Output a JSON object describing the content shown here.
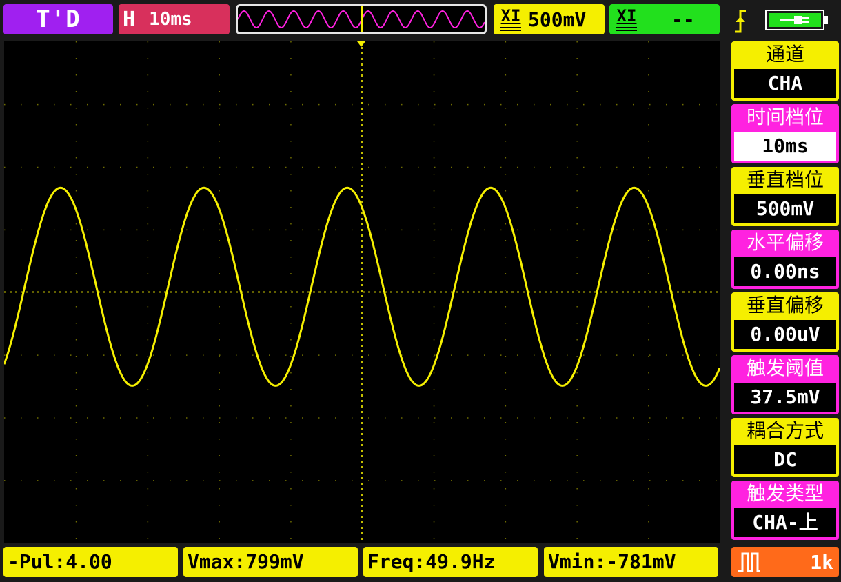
{
  "header": {
    "mode": "T'D",
    "horizontal_prefix": "H",
    "timebase": "10ms",
    "cha_volts": "500mV",
    "chb_volts": "--",
    "channel_icon_text": "XI"
  },
  "sidebar": {
    "items": [
      {
        "label": "通道",
        "value": "CHA"
      },
      {
        "label": "时间档位",
        "value": "10ms"
      },
      {
        "label": "垂直档位",
        "value": "500mV"
      },
      {
        "label": "水平偏移",
        "value": "0.00ns"
      },
      {
        "label": "垂直偏移",
        "value": "0.00uV"
      },
      {
        "label": "触发阈值",
        "value": "37.5mV"
      },
      {
        "label": "耦合方式",
        "value": "DC"
      },
      {
        "label": "触发类型",
        "value": "CHA-上"
      }
    ]
  },
  "measurements": {
    "pulse": "-Pul:4.00",
    "vmax": "Vmax:799mV",
    "freq": "Freq:49.9Hz",
    "vmin": "Vmin:-781mV"
  },
  "sample": {
    "value": "1k"
  },
  "colors": {
    "trace": "#f5ef00",
    "grid": "#f5ef00",
    "mode": "#a020f0",
    "timebase": "#d8305c",
    "cha": "#f5ef00",
    "chb": "#22e01d",
    "side_label_alt": "#ff22e0",
    "battery": "#22e01d",
    "sample_box": "#ff6a1a"
  },
  "icons": [
    "trigger-rising-edge-icon",
    "battery-icon",
    "square-wave-icon"
  ],
  "waveform": {
    "shape": "sine",
    "frequency_hz": 49.9,
    "vmax_mv": 799,
    "vmin_mv": -781,
    "volts_per_div_mv": 500,
    "time_per_div_ms": 10
  }
}
